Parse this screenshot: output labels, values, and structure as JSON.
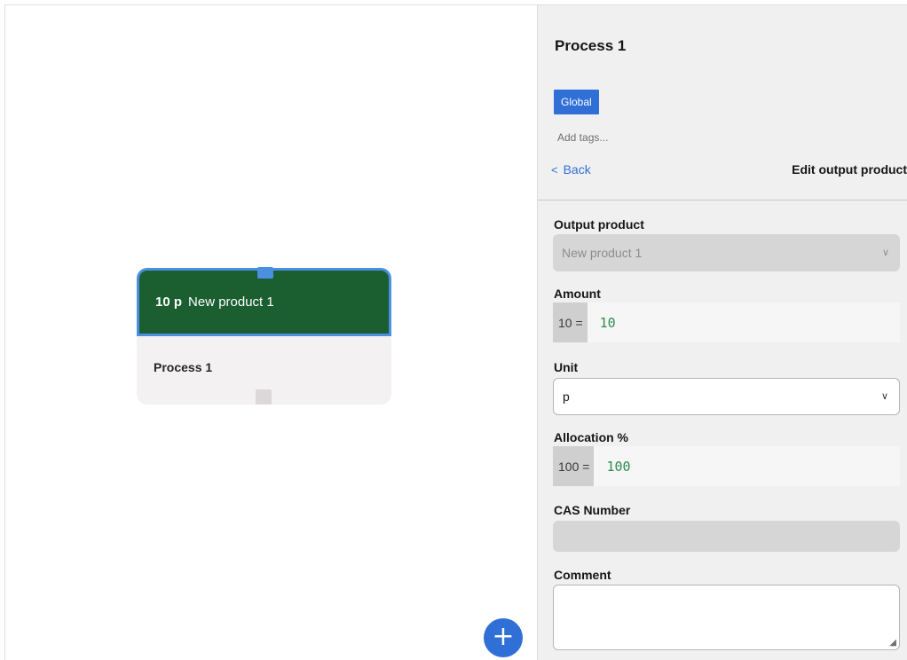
{
  "canvas": {
    "node": {
      "output_amount": "10 p",
      "output_name": "New product 1",
      "process_label": "Process 1"
    },
    "add_button_icon": "plus-icon",
    "add_button_glyph": "+"
  },
  "panel": {
    "title": "Process 1",
    "tag": "Global",
    "add_tags_placeholder": "Add tags...",
    "back_label": "Back",
    "back_icon_glyph": "<",
    "edit_title": "Edit output product",
    "fields": {
      "output_product": {
        "label": "Output product",
        "value": "New product 1"
      },
      "amount": {
        "label": "Amount",
        "prefix": "10 =",
        "value": "10"
      },
      "unit": {
        "label": "Unit",
        "value": "p"
      },
      "allocation": {
        "label": "Allocation %",
        "prefix": "100 =",
        "value": "100"
      },
      "cas_number": {
        "label": "CAS Number",
        "value": ""
      },
      "comment": {
        "label": "Comment",
        "value": ""
      }
    },
    "chevron_glyph": "∨"
  },
  "colors": {
    "accent": "#2f6fd6",
    "node_output_bg": "#1b5e30",
    "node_selected_border": "#4a8fe0",
    "formula_value": "#2e8b4e"
  }
}
